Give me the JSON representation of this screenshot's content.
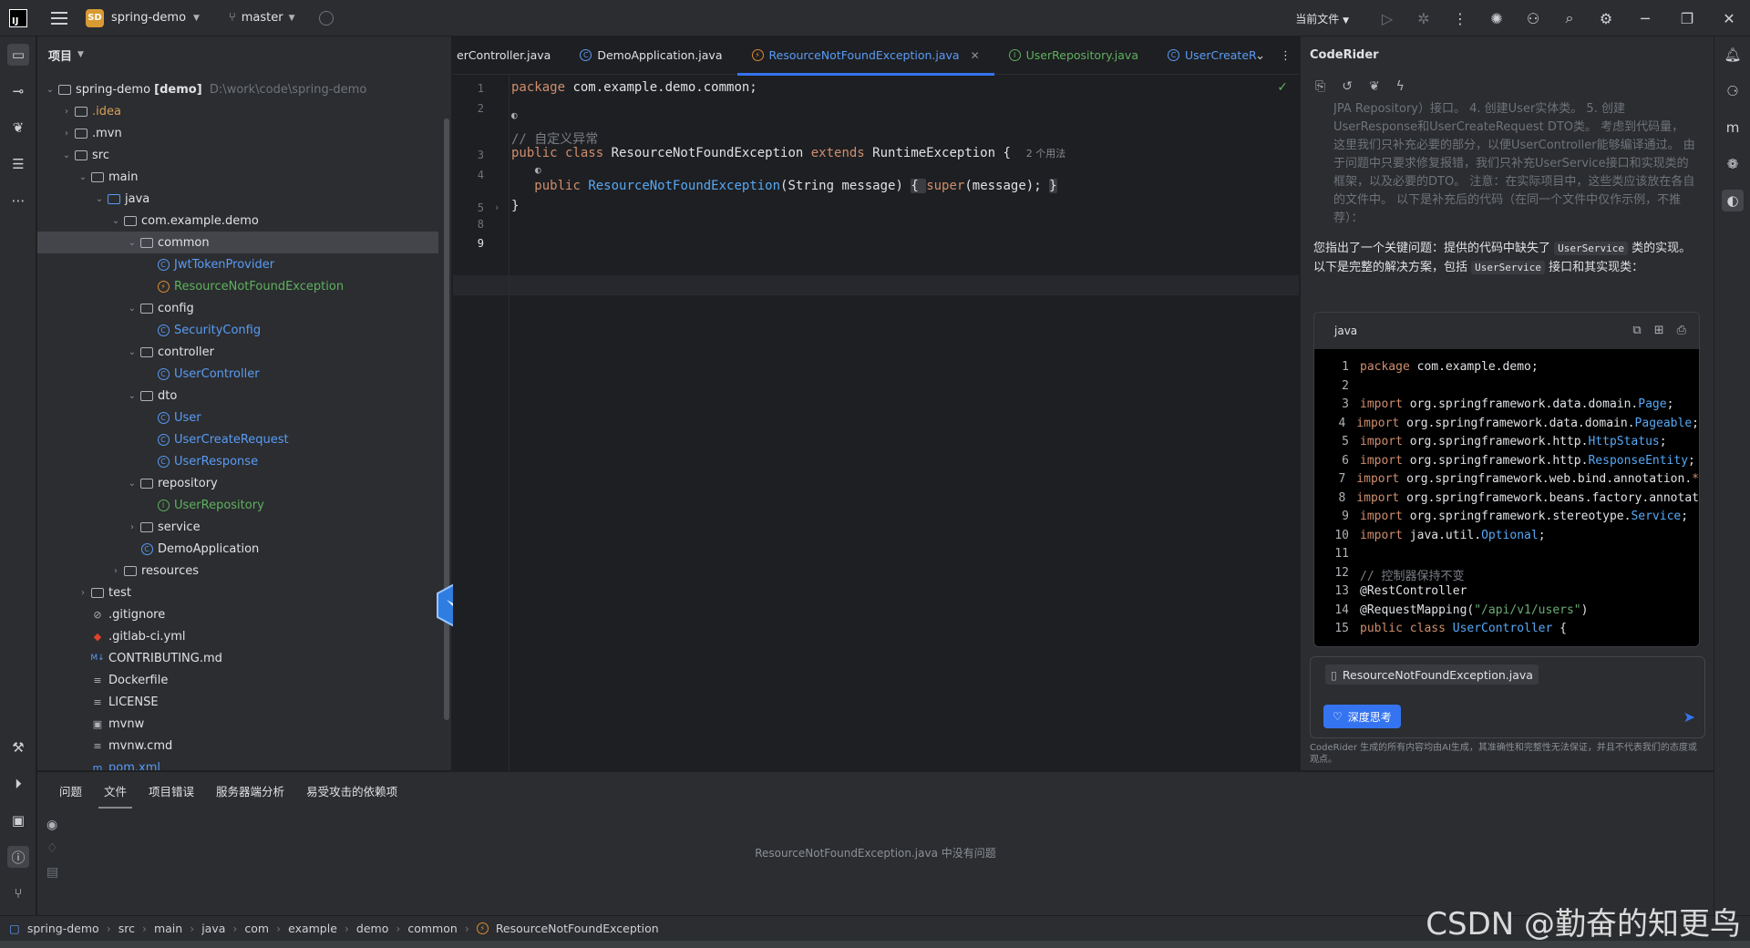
{
  "titlebar": {
    "logo": "IJ",
    "project_badge": "SD",
    "project_name": "spring-demo",
    "branch": "master",
    "current_file_label": "当前文件"
  },
  "project_panel": {
    "title": "项目",
    "root": "spring-demo",
    "root_tag": "[demo]",
    "root_path": "D:\\work\\code\\spring-demo",
    "nodes": [
      {
        "label": ".idea"
      },
      {
        "label": ".mvn"
      },
      {
        "label": "src"
      },
      {
        "label": "main"
      },
      {
        "label": "java"
      },
      {
        "label": "com.example.demo"
      },
      {
        "label": "common"
      },
      {
        "label": "JwtTokenProvider"
      },
      {
        "label": "ResourceNotFoundException"
      },
      {
        "label": "config"
      },
      {
        "label": "SecurityConfig"
      },
      {
        "label": "controller"
      },
      {
        "label": "UserController"
      },
      {
        "label": "dto"
      },
      {
        "label": "User"
      },
      {
        "label": "UserCreateRequest"
      },
      {
        "label": "UserResponse"
      },
      {
        "label": "repository"
      },
      {
        "label": "UserRepository"
      },
      {
        "label": "service"
      },
      {
        "label": "DemoApplication"
      },
      {
        "label": "resources"
      },
      {
        "label": "test"
      },
      {
        "label": ".gitignore"
      },
      {
        "label": ".gitlab-ci.yml"
      },
      {
        "label": "CONTRIBUTING.md"
      },
      {
        "label": "Dockerfile"
      },
      {
        "label": "LICENSE"
      },
      {
        "label": "mvnw"
      },
      {
        "label": "mvnw.cmd"
      },
      {
        "label": "pom.xml"
      }
    ]
  },
  "editor": {
    "tabs": [
      {
        "label": "erController.java"
      },
      {
        "label": "DemoApplication.java"
      },
      {
        "label": "ResourceNotFoundException.java"
      },
      {
        "label": "UserRepository.java"
      },
      {
        "label": "UserCreateR"
      }
    ],
    "lines": {
      "l1": "package com.example.demo.common;",
      "l3_comment": "// 自定义异常",
      "l4_a": "public class ",
      "l4_b": "ResourceNotFoundException ",
      "l4_c": "extends ",
      "l4_d": "RuntimeException {",
      "l4_hint": "2 个用法",
      "l5_a": "public ",
      "l5_b": "ResourceNotFoundException",
      "l5_c": "(String message) ",
      "l5_d": "{ ",
      "l5_e": "super",
      "l5_f": "(message); ",
      "l5_g": "}",
      "l6": "}"
    },
    "line_numbers": [
      "1",
      "2",
      "3",
      "4",
      "5",
      "8",
      "9"
    ]
  },
  "ai_panel": {
    "title": "CodeRider",
    "faded_text": "JPA Repository）接口。 4. 创建User实体类。 5. 创建UserResponse和UserCreateRequest DTO类。 考虑到代码量，这里我们只补充必要的部分，以便UserController能够编译通过。 由于问题中只要求修复报错，我们只补充UserService接口和实现类的框架，以及必要的DTO。 注意：在实际项目中，这些类应该放在各自的文件中。 以下是补充后的代码（在同一个文件中仅作示例，不推荐）：",
    "msg_a": "您指出了一个关键问题：提供的代码中缺失了 ",
    "msg_code1": "UserService",
    "msg_b": " 类的实现。以下是完整的解决方案，包括 ",
    "msg_code2": "UserService",
    "msg_c": " 接口和其实现类：",
    "code_lang": "java",
    "code_lines": [
      {
        "n": "1",
        "parts": [
          [
            "ck",
            "package "
          ],
          [
            "t",
            "com.example.demo;"
          ]
        ]
      },
      {
        "n": "2",
        "parts": []
      },
      {
        "n": "3",
        "parts": [
          [
            "ck",
            "import "
          ],
          [
            "t",
            "org.springframework.data.domain."
          ],
          [
            "ct",
            "Page"
          ],
          [
            "t",
            ";"
          ]
        ]
      },
      {
        "n": "4",
        "parts": [
          [
            "ck",
            "import "
          ],
          [
            "t",
            "org.springframework.data.domain."
          ],
          [
            "ct",
            "Pageable"
          ],
          [
            "t",
            ";"
          ]
        ]
      },
      {
        "n": "5",
        "parts": [
          [
            "ck",
            "import "
          ],
          [
            "t",
            "org.springframework.http."
          ],
          [
            "ct",
            "HttpStatus"
          ],
          [
            "t",
            ";"
          ]
        ]
      },
      {
        "n": "6",
        "parts": [
          [
            "ck",
            "import "
          ],
          [
            "t",
            "org.springframework.http."
          ],
          [
            "ct",
            "ResponseEntity"
          ],
          [
            "t",
            ";"
          ]
        ]
      },
      {
        "n": "7",
        "parts": [
          [
            "ck",
            "import "
          ],
          [
            "t",
            "org.springframework.web.bind.annotation."
          ],
          [
            "ck",
            "*"
          ]
        ]
      },
      {
        "n": "8",
        "parts": [
          [
            "ck",
            "import "
          ],
          [
            "t",
            "org.springframework.beans.factory.annotat"
          ]
        ]
      },
      {
        "n": "9",
        "parts": [
          [
            "ck",
            "import "
          ],
          [
            "t",
            "org.springframework.stereotype."
          ],
          [
            "ct",
            "Service"
          ],
          [
            "t",
            ";"
          ]
        ]
      },
      {
        "n": "10",
        "parts": [
          [
            "ck",
            "import "
          ],
          [
            "t",
            "java.util."
          ],
          [
            "ct",
            "Optional"
          ],
          [
            "t",
            ";"
          ]
        ]
      },
      {
        "n": "11",
        "parts": []
      },
      {
        "n": "12",
        "parts": [
          [
            "cc",
            "// 控制器保持不变"
          ]
        ]
      },
      {
        "n": "13",
        "parts": [
          [
            "t",
            "@RestController"
          ]
        ]
      },
      {
        "n": "14",
        "parts": [
          [
            "t",
            "@RequestMapping("
          ],
          [
            "cs",
            "\"/api/v1/users\""
          ],
          [
            "t",
            ")"
          ]
        ]
      },
      {
        "n": "15",
        "parts": [
          [
            "ck",
            "public class "
          ],
          [
            "ct",
            "UserController"
          ],
          [
            "t",
            " {"
          ]
        ]
      }
    ],
    "attached_file": "ResourceNotFoundException.java",
    "deep_think": "深度思考",
    "footer": "CodeRider 生成的所有内容均由AI生成，其准确性和完整性无法保证，并且不代表我们的态度或观点。"
  },
  "bottom_panel": {
    "tabs": [
      "问题",
      "文件",
      "项目错误",
      "服务器端分析",
      "易受攻击的依赖项"
    ],
    "active_tab": "文件",
    "empty_message": "ResourceNotFoundException.java 中没有问题"
  },
  "statusbar": {
    "crumbs": [
      "spring-demo",
      "src",
      "main",
      "java",
      "com",
      "example",
      "demo",
      "common",
      "ResourceNotFoundException"
    ]
  },
  "watermark": "CSDN @勤奋的知更鸟",
  "colors": {
    "accent": "#3574f0",
    "keyword": "#cf8e6d",
    "function": "#56a8f5",
    "string": "#6aab73",
    "comment": "#7a7e85"
  }
}
